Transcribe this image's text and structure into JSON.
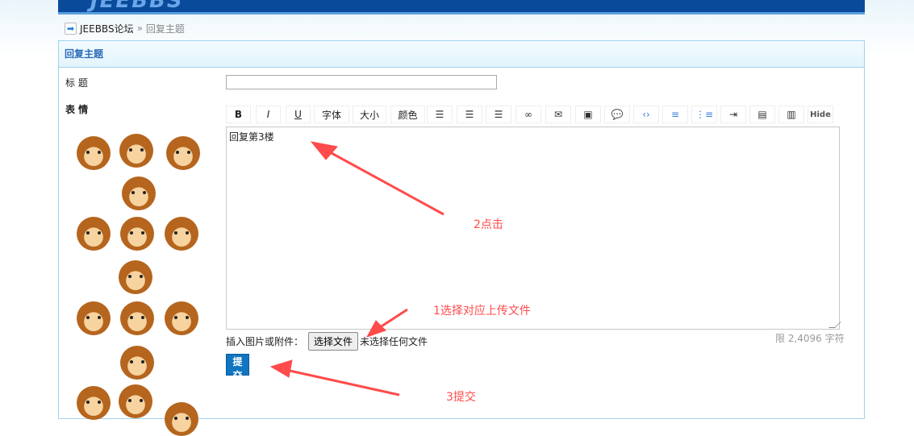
{
  "header": {
    "logo": "JEEBBS"
  },
  "breadcrumb": {
    "home": "JEEBBS论坛",
    "separator": "»",
    "current": "回复主题"
  },
  "panel": {
    "title": "回复主题"
  },
  "form": {
    "title_label": "标 题",
    "title_value": "",
    "emoticons_label": "表 情",
    "toolbar": [
      {
        "label": "B",
        "icon": "bold-icon"
      },
      {
        "label": "I",
        "icon": "italic-icon"
      },
      {
        "label": "U",
        "icon": "underline-icon"
      },
      {
        "label": "字体",
        "icon": "font-select"
      },
      {
        "label": "大小",
        "icon": "size-select"
      },
      {
        "label": "颜色",
        "icon": "color-select"
      },
      {
        "label": "",
        "icon": "align-left-icon"
      },
      {
        "label": "",
        "icon": "align-center-icon"
      },
      {
        "label": "",
        "icon": "align-right-icon"
      },
      {
        "label": "",
        "icon": "link-icon"
      },
      {
        "label": "",
        "icon": "email-link-icon"
      },
      {
        "label": "",
        "icon": "insert-image-icon"
      },
      {
        "label": "",
        "icon": "quote-icon"
      },
      {
        "label": "",
        "icon": "code-icon"
      },
      {
        "label": "",
        "icon": "ordered-list-icon"
      },
      {
        "label": "",
        "icon": "unordered-list-icon"
      },
      {
        "label": "",
        "icon": "indent-icon"
      },
      {
        "label": "",
        "icon": "image-left-icon"
      },
      {
        "label": "",
        "icon": "image-right-icon"
      },
      {
        "label": "Hide",
        "icon": "hide-icon"
      }
    ],
    "content": "回复第3楼",
    "attach_label": "插入图片或附件：",
    "file_button": "选择文件",
    "file_status": "未选择任何文件",
    "limit": "限 2,4096 字符",
    "submit": "提 交"
  },
  "annotations": {
    "a1": "1选择对应上传文件",
    "a2": "2点击",
    "a3": "3提交"
  },
  "colors": {
    "accent": "#1175c0",
    "annotation": "#ff4b4b",
    "header": "#0a4a9a"
  }
}
